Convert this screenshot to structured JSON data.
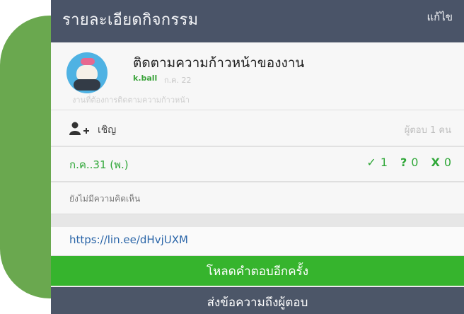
{
  "header": {
    "title": "รายละเอียดกิจกรรม",
    "edit_label": "แก้ไข"
  },
  "event": {
    "title": "ติดตามความก้าวหน้าของงาน",
    "author": "k.ball",
    "date": "ก.ค. 22",
    "description": "งานที่ต้องการติดตามความก้าวหน้า"
  },
  "invite": {
    "label": "เชิญ",
    "responders": "ผู้ตอบ 1 คน",
    "icon": "add-person-icon"
  },
  "schedule": {
    "date": "ก.ค..31 (พ.)",
    "yes_symbol": "✓",
    "yes_count": "1",
    "maybe_symbol": "?",
    "maybe_count": "0",
    "no_symbol": "X",
    "no_count": "0"
  },
  "comments": {
    "label": "ยังไม่มีความคิดเห็น"
  },
  "link": {
    "url": "https://lin.ee/dHvjUXM"
  },
  "buttons": {
    "reload_label": "โหลดคำตอบอีกครั้ง",
    "message_label": "ส่งข้อความถึงผู้ตอบ"
  },
  "colors": {
    "header_bg": "#4a5468",
    "accent_green": "#36b42d",
    "tab_green": "#6aa84f",
    "secondary_button": "#4c5668"
  }
}
